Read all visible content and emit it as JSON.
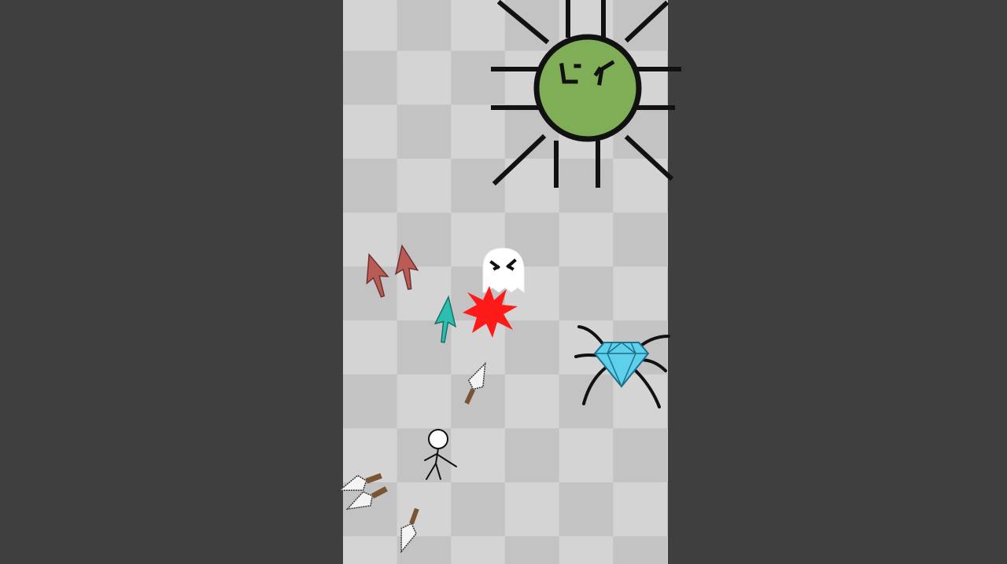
{
  "game": {
    "colors": {
      "frame_background": "#3f3f3f",
      "checker_light": "#d4d4d4",
      "checker_dark": "#c3c3c3",
      "boss_body": "#7fae57",
      "outline": "#111111",
      "ghost": "#ffffff",
      "hit_flash": "#ff1a1a",
      "red_arrow": "#b85c55",
      "teal_arrow": "#2cbfb0",
      "gem": "#5ed0ec",
      "knife_blade": "#f4f4f4",
      "knife_handle": "#7a5535"
    },
    "sprites": {
      "boss": "green-spiky-sun-boss",
      "ghost": "white-ghost-enemy",
      "hit_effect": "red-burst",
      "red_projectiles": "red-arrowhead",
      "teal_projectile": "teal-arrowhead",
      "knife": "thrown-knife",
      "gem_spider": "diamond-spider",
      "player": "stick-figure"
    }
  }
}
